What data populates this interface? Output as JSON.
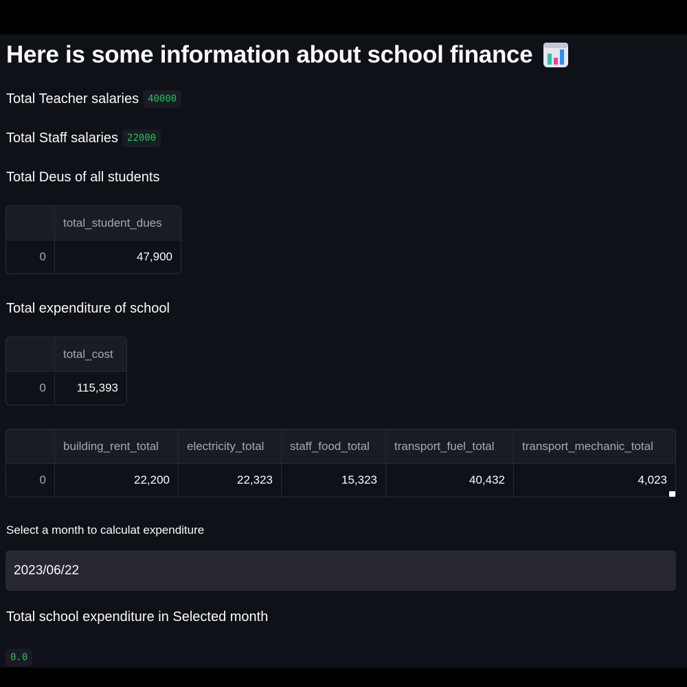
{
  "page": {
    "title": "Here is some information about school finance",
    "title_icon": "bar-chart-emoji"
  },
  "salaries": {
    "teacher_label": "Total Teacher salaries",
    "teacher_value": "40000",
    "staff_label": "Total Staff salaries",
    "staff_value": "22000"
  },
  "dues": {
    "label": "Total Deus of all students",
    "table": {
      "columns": [
        "",
        "total_student_dues"
      ],
      "rows": [
        [
          "0",
          "47,900"
        ]
      ]
    }
  },
  "expenditure": {
    "label": "Total expenditure of school",
    "table": {
      "columns": [
        "",
        "total_cost"
      ],
      "rows": [
        [
          "0",
          "115,393"
        ]
      ]
    }
  },
  "breakdown": {
    "table": {
      "columns": [
        "",
        "building_rent_total",
        "electricity_total",
        "staff_food_total",
        "transport_fuel_total",
        "transport_mechanic_total"
      ],
      "rows": [
        [
          "0",
          "22,200",
          "22,323",
          "15,323",
          "40,432",
          "4,023"
        ]
      ]
    }
  },
  "month_select": {
    "label": "Select a month to calculat expenditure",
    "value": "2023/06/22"
  },
  "monthly_total": {
    "label": "Total school expenditure in Selected month",
    "value": "0.0"
  },
  "colors": {
    "background": "#0e1117",
    "code_text": "#21c354",
    "input_bg": "#262730"
  }
}
